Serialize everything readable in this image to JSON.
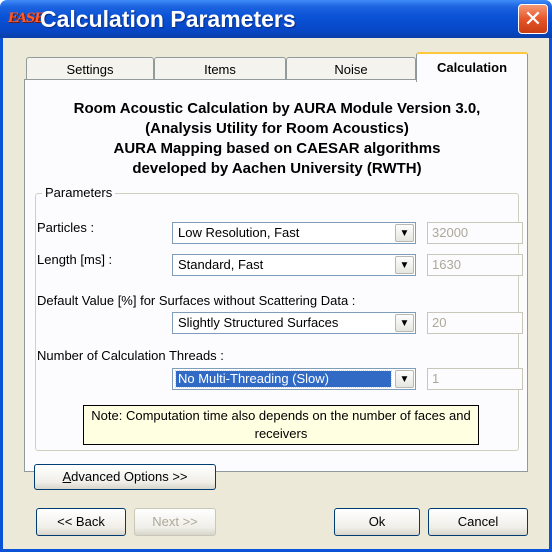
{
  "window": {
    "title": "Calculation Parameters",
    "icon_text": "EASE",
    "close_glyph": "✕"
  },
  "tabs": [
    {
      "label": "Settings",
      "active": false
    },
    {
      "label": "Items",
      "active": false
    },
    {
      "label": "Noise",
      "active": false
    },
    {
      "label": "Calculation",
      "active": true
    }
  ],
  "heading": {
    "line1": "Room Acoustic Calculation by AURA Module Version 3.0,",
    "line2": "(Analysis Utility for Room Acoustics)",
    "line3": "AURA Mapping based on CAESAR algorithms",
    "line4": "developed by Aachen University (RWTH)"
  },
  "parameters": {
    "group_label": "Parameters",
    "particles": {
      "label": "Particles :",
      "selected": "Low Resolution, Fast",
      "value": "32000"
    },
    "length": {
      "label": "Length [ms] :",
      "selected": "Standard, Fast",
      "value": "1630"
    },
    "default_value": {
      "label": "Default Value [%] for Surfaces without Scattering Data :",
      "selected": "Slightly Structured Surfaces",
      "value": "20"
    },
    "threads": {
      "label": "Number of Calculation Threads :",
      "selected": "No Multi-Threading (Slow)",
      "value": "1"
    },
    "note_line1": "Note: Computation time also depends on the number of faces and",
    "note_line2": "receivers"
  },
  "buttons": {
    "advanced_prefix": "A",
    "advanced_rest": "dvanced Options >>",
    "back": "<< Back",
    "next": "Next >>",
    "ok": "Ok",
    "cancel": "Cancel"
  },
  "icons": {
    "dropdown": "chevron-down-icon",
    "close": "close-icon"
  },
  "colors": {
    "titlebar": "#0a52d6",
    "window_bg": "#ece9d8",
    "selection": "#316ac5",
    "note_bg": "#ffffe1",
    "close_btn": "#e5562a"
  }
}
